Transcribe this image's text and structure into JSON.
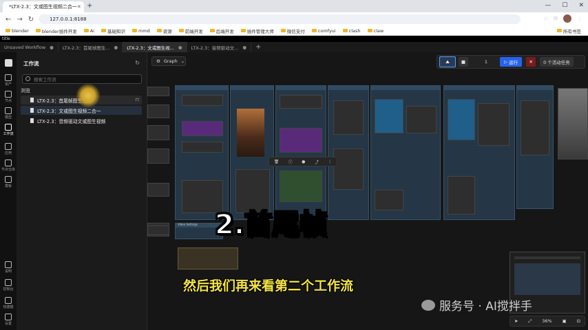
{
  "browser": {
    "tab_title": "*LTX-2.3：文或图生视频二合一",
    "url": "127.0.0.1:8188",
    "bookmarks": [
      "blender",
      "blender插件开发",
      "Ai",
      "基础知识",
      "mmd",
      "资源",
      "前端开发",
      "后端开发",
      "插件管理大师",
      "微信支付",
      "comfyui",
      "clash",
      "claw"
    ],
    "all_bookmarks": "所有书签"
  },
  "app": {
    "title": "title",
    "tabs": [
      {
        "label": "Unsaved Workflow"
      },
      {
        "label": "LTX-2.3：首尾帧图生..."
      },
      {
        "label": "LTX-2.3：文或图生视..."
      },
      {
        "label": "LTX-2.3：音频驱动文..."
      }
    ]
  },
  "rail": {
    "items": [
      "资产",
      "节点",
      "模型",
      "工作流",
      "应用",
      "节点仓库",
      "模板",
      "说明",
      "控制台",
      "快捷键",
      "设置"
    ]
  },
  "sidebar": {
    "title": "工作流",
    "search_placeholder": "搜索工作流",
    "section": "浏览",
    "items": [
      {
        "label": "LTX-2.3：首尾帧图生视频"
      },
      {
        "label": "LTX-2.3：文或图生视频二合一"
      },
      {
        "label": "LTX-2.3：音频驱动文或图生视频"
      }
    ]
  },
  "canvas": {
    "graph_label": "Graph",
    "queue_count": "1",
    "run_label": "运行",
    "tasks_label": "0 个活动任务",
    "zoom": "36%",
    "group_label": "Video Settings"
  },
  "overlay": {
    "title": "2.首尾帧",
    "subtitle": "然后我们再来看第二个工作流",
    "watermark": "服务号 · AI搅拌手"
  }
}
